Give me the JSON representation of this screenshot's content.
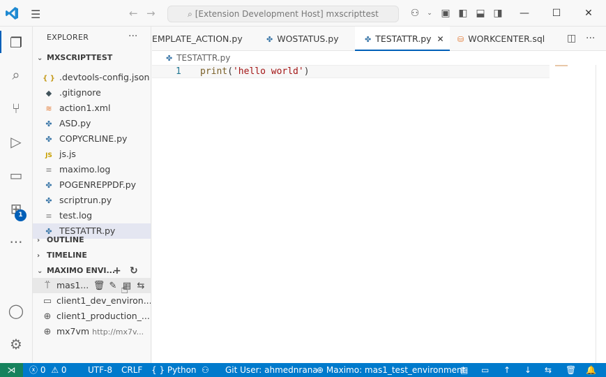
{
  "titlebar": {
    "search_text": "[Extension Development Host] mxscripttest",
    "back_icon": "arrow-left-icon",
    "forward_icon": "arrow-right-icon"
  },
  "activity": {
    "extensions_badge": "1"
  },
  "explorer": {
    "header": "EXPLORER",
    "more": "···",
    "workspace_section": "MXSCRIPTTEST",
    "files": [
      {
        "icon": "{ }",
        "name": ".devtools-config.json",
        "type": "json"
      },
      {
        "icon": "◆",
        "name": ".gitignore",
        "type": "git"
      },
      {
        "icon": "≋",
        "name": "action1.xml",
        "type": "rss"
      },
      {
        "icon": "✤",
        "name": "ASD.py",
        "type": "py"
      },
      {
        "icon": "✤",
        "name": "COPYCRLINE.py",
        "type": "py"
      },
      {
        "icon": "JS",
        "name": "js.js",
        "type": "js"
      },
      {
        "icon": "≡",
        "name": "maximo.log",
        "type": "log"
      },
      {
        "icon": "✤",
        "name": "POGENREPPDF.py",
        "type": "py"
      },
      {
        "icon": "✤",
        "name": "scriptrun.py",
        "type": "py"
      },
      {
        "icon": "≡",
        "name": "test.log",
        "type": "log"
      },
      {
        "icon": "✤",
        "name": "TESTATTR.py",
        "type": "py"
      }
    ],
    "outline_section": "OUTLINE",
    "timeline_section": "TIMELINE",
    "maximo_section": "MAXIMO ENVI...",
    "environments": [
      {
        "icon": "antenna-icon",
        "name": "mas1...",
        "sub": ""
      },
      {
        "icon": "folder-icon",
        "name": "client1_dev_environ...",
        "sub": ""
      },
      {
        "icon": "folder-icon",
        "name": "client1_production_...",
        "sub": ""
      },
      {
        "icon": "globe-icon",
        "name": "mx7vm",
        "sub": "http://mx7v..."
      }
    ]
  },
  "tabs": [
    {
      "label": "EMPLATE_ACTION.py",
      "icon": "python-icon"
    },
    {
      "label": "WOSTATUS.py",
      "icon": "python-icon"
    },
    {
      "label": "TESTATTR.py",
      "icon": "python-icon",
      "active": true
    },
    {
      "label": "WORKCENTER.sql",
      "icon": "database-icon"
    }
  ],
  "editor": {
    "breadcrumb": "TESTATTR.py",
    "line_number": "1",
    "code_fn": "print",
    "code_open": "(",
    "code_str": "'hello world'",
    "code_close": ")"
  },
  "status": {
    "errors": "0",
    "warnings": "0",
    "encoding": "UTF-8",
    "eol": "CRLF",
    "language": "Python",
    "git_user": "Git User: ahmednrana",
    "maximo_env": "Maximo: mas1_test_environment"
  },
  "colors": {
    "accent": "#005fb8",
    "statusbar": "#007acc"
  }
}
